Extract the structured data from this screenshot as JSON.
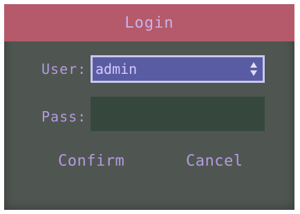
{
  "dialog": {
    "title": "Login",
    "user_label": "User:",
    "user_value": "admin",
    "pass_label": "Pass:",
    "pass_value": "",
    "confirm_label": "Confirm",
    "cancel_label": "Cancel"
  },
  "icons": {
    "user_select_spinner": "up-down-arrows-icon"
  },
  "colors": {
    "title_bar": "#b45a6a",
    "dialog_bg": "#4f5651",
    "text": "#b49be0",
    "select_bg": "#5a5ca3",
    "select_border": "#c8c9f0",
    "password_bg": "#36483e"
  }
}
